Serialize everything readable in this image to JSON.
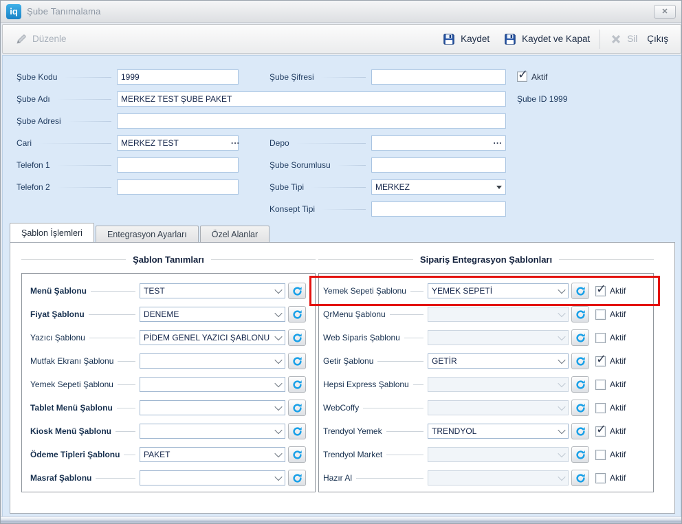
{
  "window": {
    "title": "Şube Tanımalama",
    "logo": "iq"
  },
  "toolbar": {
    "edit": "Düzenle",
    "save": "Kaydet",
    "save_close": "Kaydet ve Kapat",
    "delete": "Sil",
    "exit": "Çıkış"
  },
  "form": {
    "sube_kodu": {
      "label": "Şube Kodu",
      "value": "1999"
    },
    "sube_sifresi": {
      "label": "Şube Şifresi",
      "value": ""
    },
    "aktif": {
      "label": "Aktif",
      "checked": true
    },
    "sube_adi": {
      "label": "Şube Adı",
      "value": "MERKEZ TEST ŞUBE PAKET"
    },
    "sube_id": "Şube ID 1999",
    "sube_adresi": {
      "label": "Şube Adresi",
      "value": ""
    },
    "cari": {
      "label": "Cari",
      "value": "MERKEZ TEST",
      "browse": "..."
    },
    "depo": {
      "label": "Depo",
      "value": "",
      "browse": "..."
    },
    "telefon1": {
      "label": "Telefon 1",
      "value": ""
    },
    "sube_sorumlusu": {
      "label": "Şube Sorumlusu",
      "value": ""
    },
    "telefon2": {
      "label": "Telefon 2",
      "value": ""
    },
    "sube_tipi": {
      "label": "Şube Tipi",
      "value": "MERKEZ"
    },
    "konsept_tipi": {
      "label": "Konsept Tipi",
      "value": ""
    }
  },
  "tabs": [
    {
      "label": "Şablon İşlemleri",
      "active": true
    },
    {
      "label": "Entegrasyon Ayarları",
      "active": false
    },
    {
      "label": "Özel Alanlar",
      "active": false
    }
  ],
  "template_group": {
    "title": "Şablon Tanımları",
    "rows": [
      {
        "label": "Menü Şablonu",
        "value": "TEST",
        "bold": true
      },
      {
        "label": "Fiyat Şablonu",
        "value": "DENEME",
        "bold": true
      },
      {
        "label": "Yazıcı Şablonu",
        "value": "PİDEM GENEL YAZICI ŞABLONU",
        "bold": false
      },
      {
        "label": "Mutfak Ekranı Şablonu",
        "value": "",
        "bold": false
      },
      {
        "label": "Yemek Sepeti Şablonu",
        "value": "",
        "bold": false
      },
      {
        "label": "Tablet Menü Şablonu",
        "value": "",
        "bold": true
      },
      {
        "label": "Kiosk Menü Şablonu",
        "value": "",
        "bold": true
      },
      {
        "label": "Ödeme Tipleri Şablonu",
        "value": "PAKET",
        "bold": true
      },
      {
        "label": "Masraf Şablonu",
        "value": "",
        "bold": true
      }
    ]
  },
  "integration_group": {
    "title": "Sipariş Entegrasyon Şablonları",
    "aktif_label": "Aktif",
    "rows": [
      {
        "label": "Yemek Sepeti Şablonu",
        "value": "YEMEK SEPETİ",
        "enabled": true,
        "active": true,
        "highlighted": true
      },
      {
        "label": "QrMenu Şablonu",
        "value": "",
        "enabled": false,
        "active": false,
        "highlighted": false
      },
      {
        "label": "Web Siparis Şablonu",
        "value": "",
        "enabled": false,
        "active": false,
        "highlighted": false
      },
      {
        "label": "Getir Şablonu",
        "value": "GETİR",
        "enabled": true,
        "active": true,
        "highlighted": false
      },
      {
        "label": "Hepsi Express Şablonu",
        "value": "",
        "enabled": false,
        "active": false,
        "highlighted": false
      },
      {
        "label": "WebCoffy",
        "value": "",
        "enabled": false,
        "active": false,
        "highlighted": false
      },
      {
        "label": "Trendyol Yemek",
        "value": "TRENDYOL",
        "enabled": true,
        "active": true,
        "highlighted": false
      },
      {
        "label": "Trendyol Market",
        "value": "",
        "enabled": false,
        "active": false,
        "highlighted": false
      },
      {
        "label": "Hazır Al",
        "value": "",
        "enabled": false,
        "active": false,
        "highlighted": false
      }
    ]
  },
  "colors": {
    "accent_blue": "#1a82c6",
    "form_bg": "#dbe9f8",
    "highlight_red": "#e3130f",
    "refresh_icon_blue": "#18a0e8"
  }
}
